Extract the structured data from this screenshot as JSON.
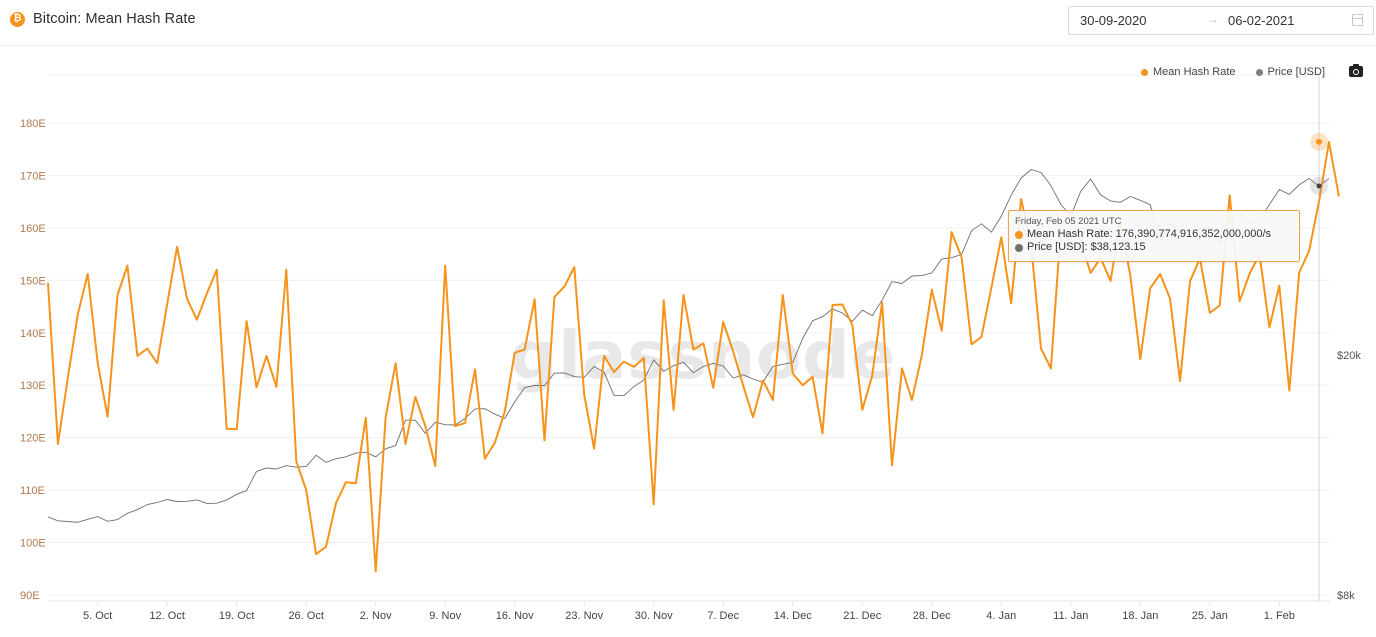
{
  "header": {
    "title": "Bitcoin: Mean Hash Rate",
    "icon": "bitcoin-icon",
    "date_start": "30-09-2020",
    "date_arrow": "→",
    "date_end": "06-02-2021",
    "calendar_icon": "calendar-icon"
  },
  "legend": [
    {
      "label": "Mean Hash Rate",
      "color": "#f7931a"
    },
    {
      "label": "Price [USD]",
      "color": "#808080"
    }
  ],
  "camera_icon": "camera-icon",
  "watermark": "glassnode",
  "tooltip": {
    "date": "Friday, Feb 05 2021 UTC",
    "hash_label": "Mean Hash Rate: 176,390,774,916,352,000,000/s",
    "price_label": "Price [USD]: $38,123.15",
    "hash_color": "#f7931a",
    "price_color": "#808080"
  },
  "chart_data": {
    "type": "line",
    "title": "Bitcoin: Mean Hash Rate",
    "x_start": "2020-09-30",
    "x_end": "2021-02-06",
    "x_ticks": [
      "5. Oct",
      "12. Oct",
      "19. Oct",
      "26. Oct",
      "2. Nov",
      "9. Nov",
      "16. Nov",
      "23. Nov",
      "30. Nov",
      "7. Dec",
      "14. Dec",
      "21. Dec",
      "28. Dec",
      "4. Jan",
      "11. Jan",
      "18. Jan",
      "25. Jan",
      "1. Feb"
    ],
    "x_tick_days": [
      5,
      12,
      19,
      26,
      33,
      40,
      47,
      54,
      61,
      68,
      75,
      82,
      89,
      96,
      103,
      110,
      117,
      124
    ],
    "y_left": {
      "label": "Mean Hash Rate",
      "unit": "E",
      "ticks": [
        "90E",
        "100E",
        "110E",
        "120E",
        "130E",
        "140E",
        "150E",
        "160E",
        "170E",
        "180E"
      ],
      "tick_values": [
        90,
        100,
        110,
        120,
        130,
        140,
        150,
        160,
        170,
        180
      ],
      "range": [
        90,
        189
      ]
    },
    "y_right": {
      "label": "Price [USD]",
      "scale": "log",
      "ticks": [
        "$8k",
        "$20k"
      ],
      "tick_values": [
        8000,
        20000
      ],
      "range": [
        8000,
        50000
      ]
    },
    "grid": true,
    "legend_position": "top-right",
    "series": [
      {
        "name": "Mean Hash Rate",
        "unit": "EH/s",
        "color": "#f7931a",
        "values": [
          149.5,
          118.8,
          131.5,
          143.5,
          151.2,
          134.2,
          124.0,
          147.2,
          152.8,
          135.6,
          137.0,
          134.2,
          145.5,
          156.4,
          146.5,
          142.5,
          147.5,
          152.0,
          121.7,
          121.6,
          142.2,
          129.6,
          135.6,
          129.7,
          152.0,
          115.5,
          110.0,
          97.8,
          99.2,
          107.5,
          111.5,
          111.3,
          123.8,
          94.5,
          123.8,
          134.2,
          118.8,
          127.8,
          122.2,
          114.6,
          152.8,
          122.2,
          122.8,
          133.0,
          116.0,
          119.0,
          125.0,
          136.2,
          136.8,
          146.4,
          119.5,
          146.8,
          148.8,
          152.5,
          128.2,
          117.9,
          135.6,
          132.5,
          134.5,
          133.5,
          135.2,
          107.3,
          146.2,
          125.3,
          147.2,
          136.8,
          138.0,
          129.5,
          142.1,
          136.4,
          130.0,
          123.9,
          130.9,
          127.2,
          147.2,
          132.2,
          130.0,
          131.6,
          120.8,
          145.3,
          145.4,
          141.5,
          125.3,
          131.8,
          145.8,
          114.7,
          133.2,
          127.2,
          135.7,
          148.2,
          140.4,
          159.2,
          154.4,
          137.8,
          139.2,
          148.6,
          158.2,
          145.6,
          165.5,
          156.8,
          137.0,
          133.2,
          160.2,
          163.0,
          157.5,
          151.4,
          154.3,
          149.9,
          161.0,
          150.8,
          135.0,
          148.5,
          151.2,
          146.5,
          130.8,
          149.8,
          154.2,
          143.8,
          145.2,
          166.2,
          146.0,
          151.2,
          155.0,
          141.0,
          149.0,
          129.0,
          151.5,
          155.6,
          165.0,
          176.4,
          166.0
        ]
      },
      {
        "name": "Price [USD]",
        "unit": "USD",
        "color": "#808080",
        "values": [
          10780,
          10620,
          10590,
          10560,
          10680,
          10790,
          10600,
          10670,
          10930,
          11080,
          11300,
          11390,
          11520,
          11430,
          11440,
          11500,
          11350,
          11360,
          11500,
          11750,
          11920,
          12820,
          12990,
          12940,
          13110,
          13030,
          13070,
          13640,
          13270,
          13460,
          13560,
          13750,
          13800,
          13560,
          13980,
          14150,
          15590,
          15590,
          14830,
          15470,
          15330,
          15310,
          15700,
          16280,
          16290,
          15960,
          15700,
          16720,
          17660,
          17800,
          17800,
          18660,
          18680,
          18420,
          18360,
          19150,
          18720,
          17150,
          17120,
          17730,
          18170,
          19630,
          18790,
          19200,
          19450,
          18690,
          19150,
          19370,
          19180,
          18320,
          18550,
          18250,
          18030,
          19150,
          19300,
          19440,
          21300,
          22800,
          23150,
          23850,
          23480,
          22740,
          23740,
          23250,
          24650,
          26470,
          26280,
          27040,
          27080,
          27360,
          28840,
          29000,
          29370,
          32130,
          33000,
          31970,
          33990,
          36820,
          39290,
          40600,
          40150,
          38190,
          35530,
          34000,
          37370,
          39160,
          36860,
          36000,
          35830,
          36630,
          36100,
          35500,
          30830,
          33000,
          32110,
          32290,
          32250,
          32510,
          30440,
          33420,
          34270,
          33110,
          33520,
          35520,
          37620,
          36930,
          38290,
          39250,
          38120,
          39200
        ]
      }
    ],
    "highlighted_point": {
      "date": "2021-02-05",
      "mean_hash_rate": 176.39,
      "price_usd": 38123.15
    }
  }
}
